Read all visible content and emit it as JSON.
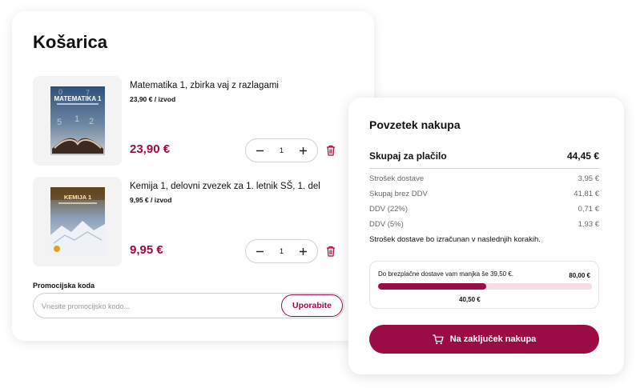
{
  "cart": {
    "title": "Košarica",
    "items": [
      {
        "name": "Matematika 1, zbirka vaj z razlagami",
        "unit_price": "23,90 € / izvod",
        "price": "23,90 €",
        "quantity": "1",
        "cover_title": "MATEMATIKA 1"
      },
      {
        "name": "Kemija 1, delovni zvezek za 1. letnik SŠ, 1. del",
        "unit_price": "9,95 € / izvod",
        "price": "9,95 €",
        "quantity": "1",
        "cover_title": "KEMIJA 1"
      }
    ],
    "promo": {
      "label": "Promocijska koda",
      "placeholder": "Vnesite promocijsko kodo...",
      "apply_label": "Uporabite"
    }
  },
  "summary": {
    "title": "Povzetek nakupa",
    "total_label": "Skupaj za plačilo",
    "total_value": "44,45 €",
    "rows": [
      {
        "label": "Strošek dostave",
        "value": "3,95 €"
      },
      {
        "label": "Skupaj brez DDV",
        "value": "41,81 €"
      },
      {
        "label": "DDV (22%)",
        "value": "0,71 €"
      },
      {
        "label": "DDV (5%)",
        "value": "1,93 €"
      }
    ],
    "note": "Strošek dostave bo izračunan v naslednjih korakih.",
    "free_shipping": {
      "text": "Do brezplačne dostave vam manjka še 39,50 €.",
      "goal": "80,00 €",
      "current": "40,50 €",
      "progress_percent": 50.6
    },
    "checkout_label": "Na zaključek nakupa"
  },
  "colors": {
    "accent": "#9b0c44",
    "progress_track": "#f6dde5"
  },
  "icons": {
    "minus": "minus-icon",
    "plus": "plus-icon",
    "trash": "trash-icon",
    "cart": "cart-icon"
  }
}
